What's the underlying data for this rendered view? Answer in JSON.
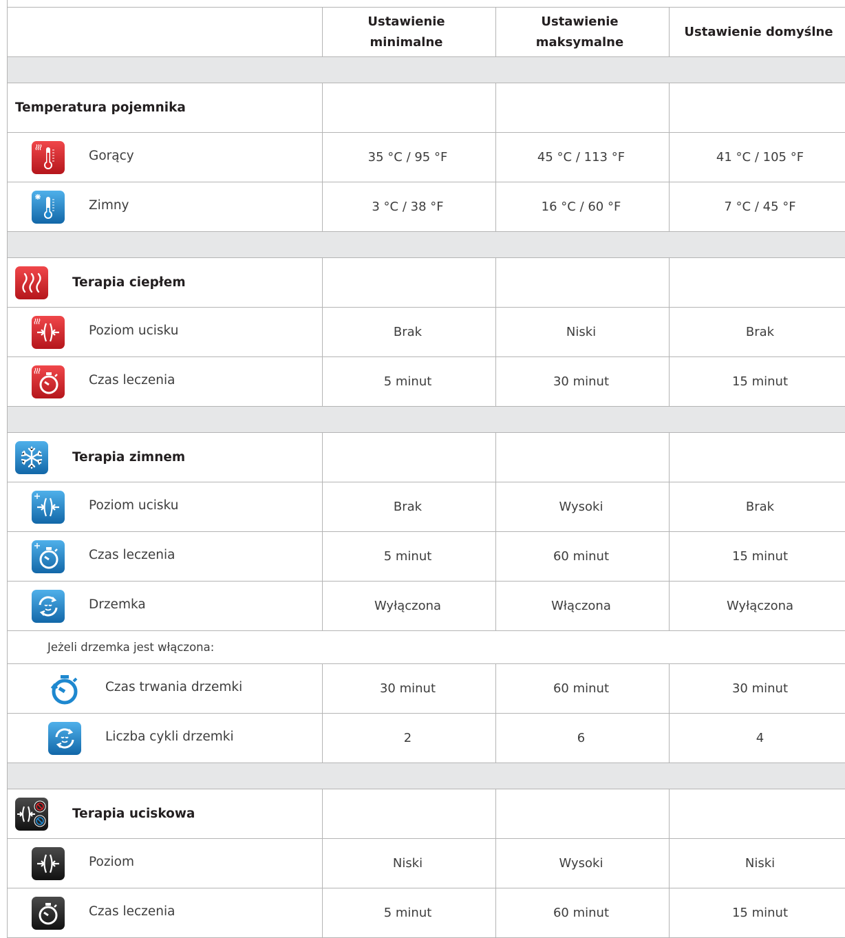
{
  "columns": {
    "col1": "",
    "min": "Ustawienie minimalne",
    "max_line1": "Ustawienie",
    "max_line2": "maksymalne",
    "default": "Ustawienie domyślne"
  },
  "container_temp": {
    "title": "Temperatura pojemnika",
    "hot": {
      "label": "Gorący",
      "icon": "hot-thermometer-icon",
      "min": "35 °C / 95 °F",
      "max": "45 °C / 113 °F",
      "default": "41 °C / 105 °F"
    },
    "cold": {
      "label": "Zimny",
      "icon": "cold-thermometer-icon",
      "min": "3 °C / 38 °F",
      "max": "16 °C / 60 °F",
      "default": "7 °C / 45 °F"
    }
  },
  "heat_therapy": {
    "title": "Terapia ciepłem",
    "icon": "heat-waves-icon",
    "pressure": {
      "label": "Poziom ucisku",
      "icon": "heat-compression-icon",
      "min": "Brak",
      "max": "Niski",
      "default": "Brak"
    },
    "time": {
      "label": "Czas leczenia",
      "icon": "heat-timer-icon",
      "min": "5 minut",
      "max": "30 minut",
      "default": "15 minut"
    }
  },
  "cold_therapy": {
    "title": "Terapia zimnem",
    "icon": "snowflake-icon",
    "pressure": {
      "label": "Poziom ucisku",
      "icon": "cold-compression-icon",
      "min": "Brak",
      "max": "Wysoki",
      "default": "Brak"
    },
    "time": {
      "label": "Czas leczenia",
      "icon": "cold-timer-icon",
      "min": "5 minut",
      "max": "60 minut",
      "default": "15 minut"
    },
    "snooze": {
      "label": "Drzemka",
      "icon": "snooze-cycle-icon",
      "min": "Wyłączona",
      "max": "Włączona",
      "default": "Wyłączona"
    },
    "note": "Jeżeli drzemka jest włączona:",
    "snooze_duration": {
      "label": "Czas trwania drzemki",
      "icon": "snooze-timer-icon",
      "min": "30 minut",
      "max": "60 minut",
      "default": "30 minut"
    },
    "snooze_cycles": {
      "label": "Liczba cykli drzemki",
      "icon": "snooze-cycles-icon",
      "min": "2",
      "max": "6",
      "default": "4"
    }
  },
  "compression_therapy": {
    "title": "Terapia uciskowa",
    "icon": "compression-no-temp-icon",
    "level": {
      "label": "Poziom",
      "icon": "compression-icon",
      "min": "Niski",
      "max": "Wysoki",
      "default": "Niski"
    },
    "time": {
      "label": "Czas leczenia",
      "icon": "compression-timer-icon",
      "min": "5 minut",
      "max": "60 minut",
      "default": "15 minut"
    }
  },
  "colors": {
    "border": "#b4b4b4",
    "separator": "#e6e7e8",
    "red_icon": "#d7262b",
    "blue_icon": "#1e88cf",
    "black_icon": "#1f1f1f"
  }
}
